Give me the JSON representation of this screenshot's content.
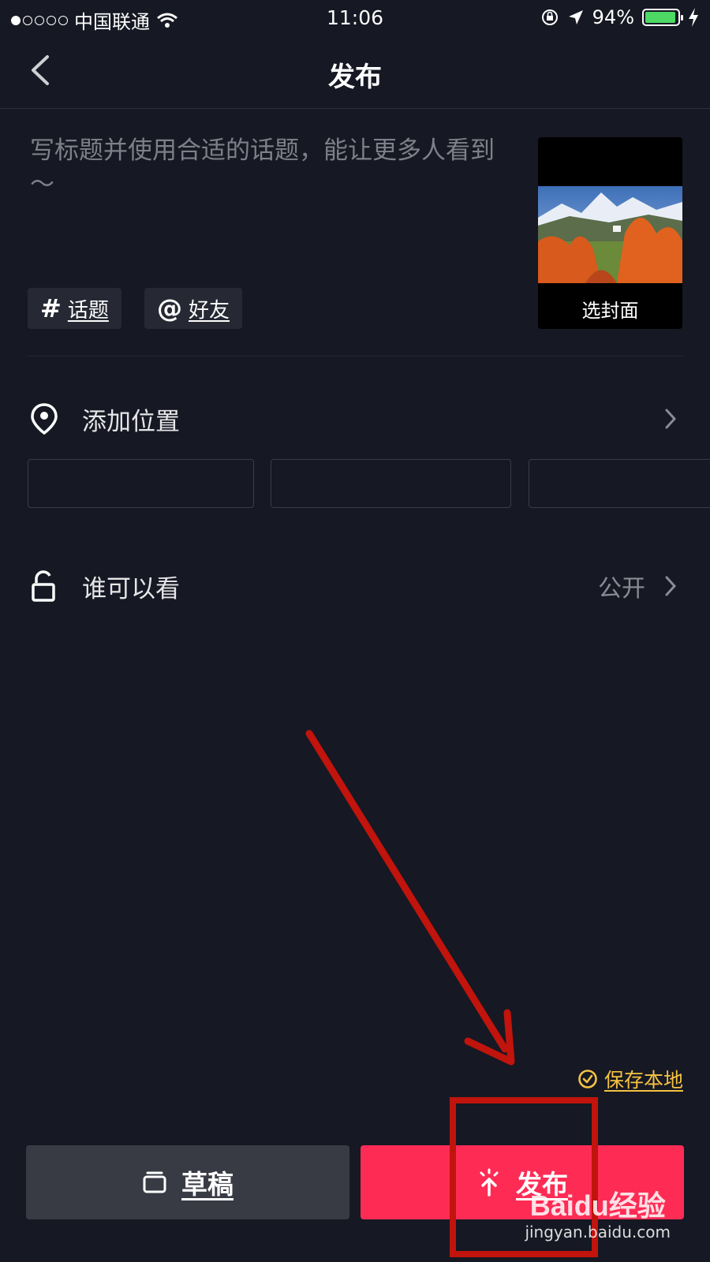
{
  "status_bar": {
    "carrier": "中国联通",
    "time": "11:06",
    "battery_percent": "94%",
    "battery_level": 0.94,
    "signal_bars": 1
  },
  "nav": {
    "title": "发布",
    "back_icon": "chevron-left-icon"
  },
  "compose": {
    "caption_placeholder": "写标题并使用合适的话题，能让更多人看到～",
    "hashtag_chip": {
      "symbol": "#",
      "label": "话题"
    },
    "mention_chip": {
      "symbol": "@",
      "label": "好友"
    },
    "cover_label": "选封面"
  },
  "location": {
    "label": "添加位置",
    "icon": "location-pin-icon"
  },
  "visibility": {
    "label": "谁可以看",
    "value": "公开",
    "icon": "unlock-icon"
  },
  "save_local": {
    "label": "保存本地",
    "icon": "check-circle-icon",
    "checked": true
  },
  "actions": {
    "draft_label": "草稿",
    "draft_icon": "drafts-box-icon",
    "publish_label": "发布",
    "publish_icon": "upload-arrow-icon"
  },
  "watermark": {
    "logo": "Baidu经验",
    "url": "jingyan.baidu.com"
  },
  "colors": {
    "background": "#161823",
    "publish": "#fe2c55",
    "draft": "#393b44",
    "save_local": "#f5c242",
    "annotation": "#c0140c",
    "battery": "#4cd964"
  }
}
